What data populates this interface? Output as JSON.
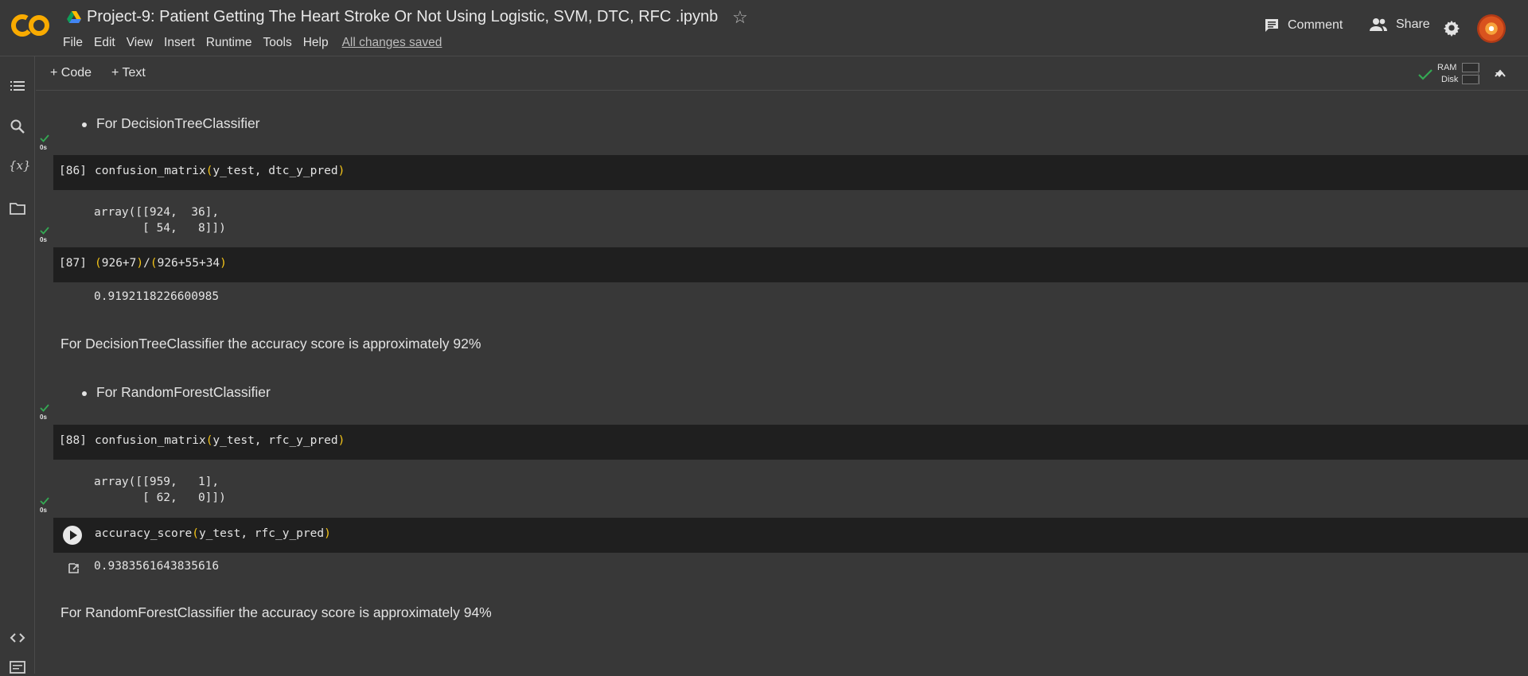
{
  "header": {
    "title": "Project-9: Patient Getting The Heart Stroke Or Not Using Logistic,  SVM, DTC, RFC .ipynb",
    "menu": [
      "File",
      "Edit",
      "View",
      "Insert",
      "Runtime",
      "Tools",
      "Help"
    ],
    "saved_status": "All changes saved",
    "comment_label": "Comment",
    "share_label": "Share"
  },
  "toolbar": {
    "add_code": "+ Code",
    "add_text": "+ Text",
    "ram_label": "RAM",
    "disk_label": "Disk"
  },
  "cells": {
    "bullet1": "For DecisionTreeClassifier",
    "c86": {
      "exec": "[86]",
      "fn": "confusion_matrix",
      "args": "y_test, dtc_y_pred",
      "status": "0s",
      "output": "array([[924,  36],\n       [ 54,   8]])"
    },
    "c87": {
      "exec": "[87]",
      "code_a": "926+7",
      "code_b": "926+55+34",
      "status": "0s",
      "output": "0.9192118226600985"
    },
    "md1": "For DecisionTreeClassifier the accuracy score is approximately 92%",
    "bullet2": "For RandomForestClassifier",
    "c88": {
      "exec": "[88]",
      "fn": "confusion_matrix",
      "args": "y_test, rfc_y_pred",
      "status": "0s",
      "output": "array([[959,   1],\n       [ 62,   0]])"
    },
    "c89": {
      "fn": "accuracy_score",
      "args": "y_test, rfc_y_pred",
      "status": "0s",
      "output": "0.9383561643835616"
    },
    "md2": "For RandomForestClassifier the accuracy score is approximately 94%"
  },
  "colors": {
    "background": "#383838",
    "code_cell": "#1f1f1f",
    "paren": "#f5c518",
    "success": "#34a853"
  }
}
